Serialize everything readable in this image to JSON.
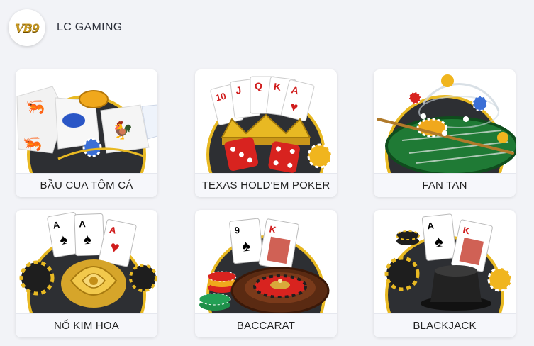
{
  "provider": {
    "logo_text": "VB9",
    "name": "LC GAMING"
  },
  "games": [
    {
      "label": "BẦU CUA TÔM CÁ",
      "icon": "bau-cua-dice-art"
    },
    {
      "label": "TEXAS HOLD'EM POKER",
      "icon": "poker-cards-crown-art"
    },
    {
      "label": "FAN TAN",
      "icon": "fan-tan-table-art"
    },
    {
      "label": "NỔ KIM HOA",
      "icon": "aces-golden-rose-art"
    },
    {
      "label": "BACCARAT",
      "icon": "baccarat-roulette-art"
    },
    {
      "label": "BLACKJACK",
      "icon": "blackjack-hat-art"
    }
  ],
  "colors": {
    "background": "#f2f3f7",
    "card": "#ffffff",
    "gold": "#e8b923",
    "dark_disc": "#2d2f33"
  }
}
